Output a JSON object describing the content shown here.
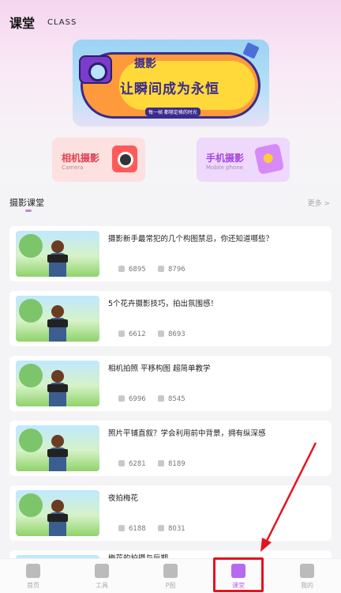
{
  "header": {
    "title": "课堂",
    "subtitle": "CLASS"
  },
  "banner": {
    "headline_small": "摄影",
    "headline_large": "让瞬间成为永恒",
    "tagline": "每一帧 都够定格的时光"
  },
  "quick_cards": [
    {
      "title": "相机摄影",
      "subtitle": "Camera"
    },
    {
      "title": "手机摄影",
      "subtitle": "Mobile phone"
    }
  ],
  "section": {
    "title": "摄影课堂",
    "more_label": "更多 >"
  },
  "lessons": [
    {
      "title": "摄影新手最常犯的几个构图禁忌，你还知道哪些？",
      "likes": "6895",
      "views": "8796"
    },
    {
      "title": "5个花卉摄影技巧，拍出氛围感！",
      "likes": "6612",
      "views": "8693"
    },
    {
      "title": "相机拍照 平移构图 超简单教学",
      "likes": "6996",
      "views": "8545"
    },
    {
      "title": "照片平铺直叙？学会利用前中背景，拥有纵深感",
      "likes": "6281",
      "views": "8189"
    },
    {
      "title": "夜拍梅花",
      "likes": "6188",
      "views": "8031"
    },
    {
      "title": "梅花的拍摄与后期",
      "likes": "",
      "views": ""
    }
  ],
  "tabbar": {
    "tabs": [
      {
        "label": "首页",
        "icon": "home-icon"
      },
      {
        "label": "工具",
        "icon": "tool-icon"
      },
      {
        "label": "P图",
        "icon": "image-edit-icon"
      },
      {
        "label": "课堂",
        "icon": "classroom-icon",
        "active": true
      },
      {
        "label": "我的",
        "icon": "profile-icon"
      }
    ]
  },
  "colors": {
    "accent": "#b76af0",
    "annotation_red": "#e5121f"
  }
}
